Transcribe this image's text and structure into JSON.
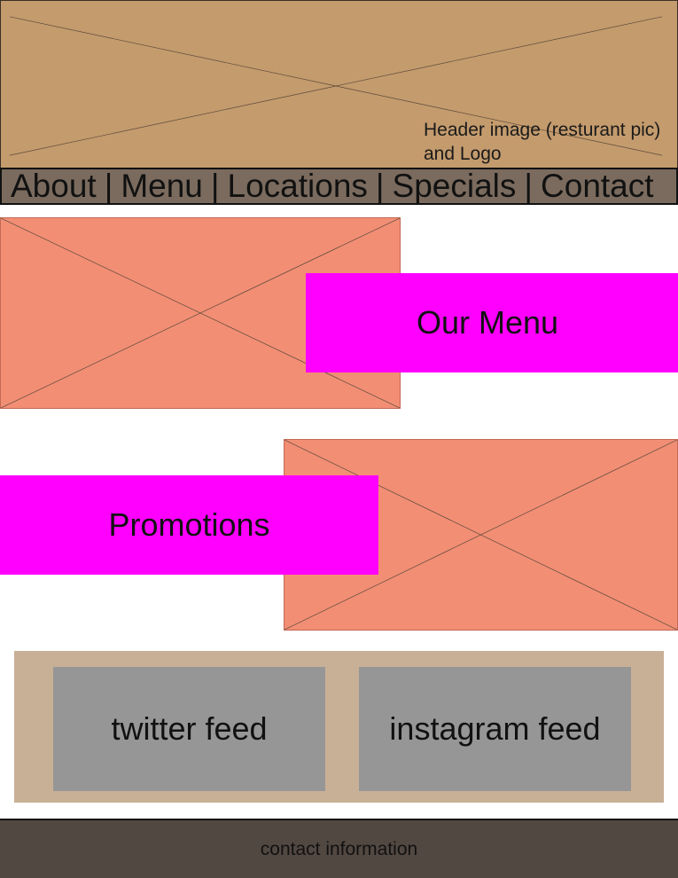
{
  "header": {
    "caption_line1": "Header image (resturant pic)",
    "caption_line2": "and Logo",
    "background_color": "#c49b6d"
  },
  "nav": {
    "items": [
      {
        "label": "About"
      },
      {
        "label": "Menu"
      },
      {
        "label": "Locations"
      },
      {
        "label": "Specials"
      },
      {
        "label": "Contact"
      }
    ],
    "separator": "|",
    "background_color": "#7a6b5e"
  },
  "sections": {
    "menu": {
      "label": "Our Menu"
    },
    "promotions": {
      "label": "Promotions"
    },
    "label_box_color": "#ff00ff",
    "image_placeholder_color": "#f28e74"
  },
  "social": {
    "twitter": "twitter feed",
    "instagram": "instagram feed",
    "panel_color": "#c8b096",
    "feed_color": "#979696"
  },
  "footer": {
    "text": "contact information",
    "background_color": "#524842"
  }
}
